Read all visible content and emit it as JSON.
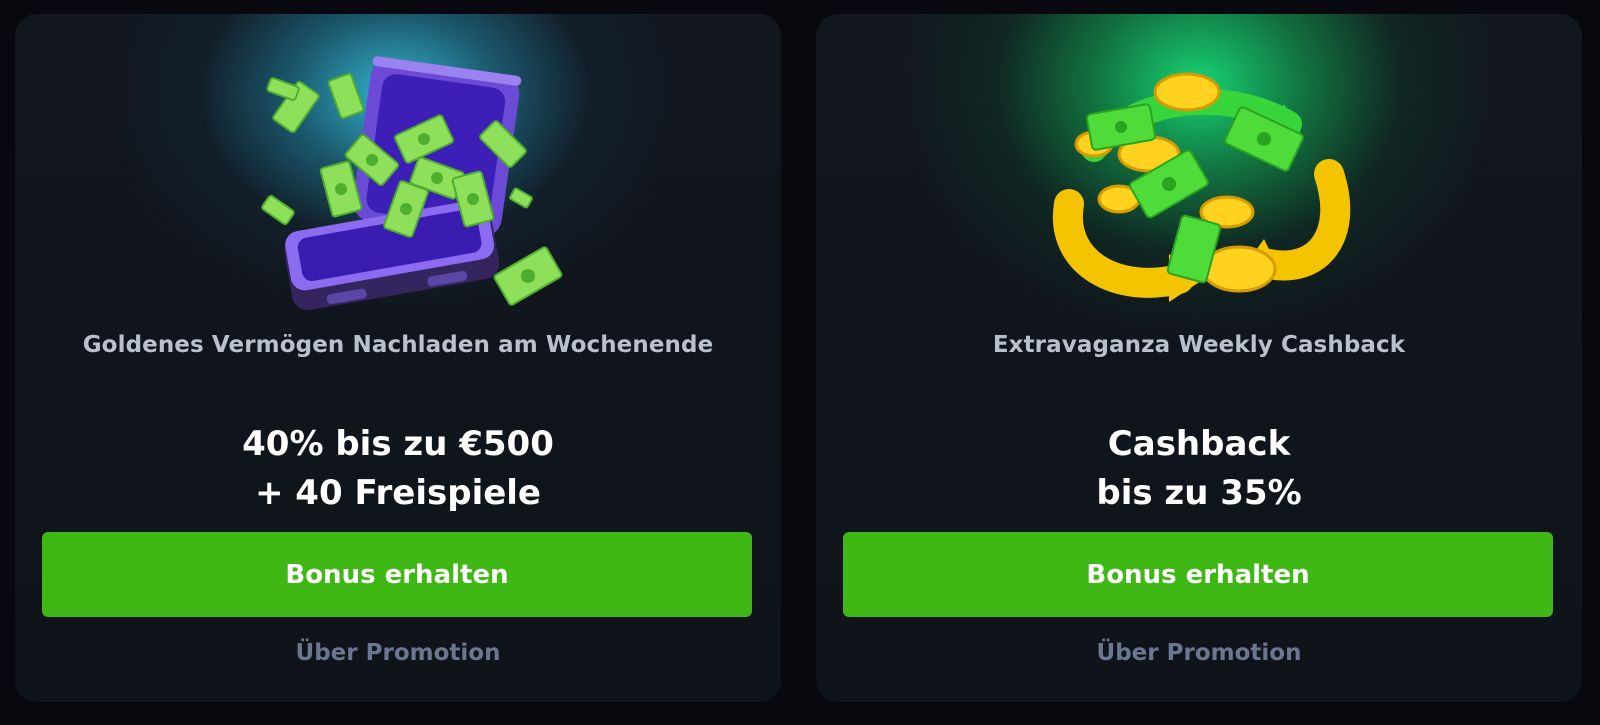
{
  "promotions": [
    {
      "title": "Goldenes Vermögen Nachladen am Wochenende",
      "offer_line1": "40% bis zu €500",
      "offer_line2": "+ 40 Freispiele",
      "button_label": "Bonus erhalten",
      "about_label": "Über Promotion",
      "icon": "money-briefcase-icon",
      "glow_color": "#34bed6"
    },
    {
      "title": "Extravaganza Weekly Cashback",
      "offer_line1": "Cashback",
      "offer_line2": "bis zu 35%",
      "button_label": "Bonus erhalten",
      "about_label": "Über Promotion",
      "icon": "cashback-coins-icon",
      "glow_color": "#18dc78"
    }
  ],
  "colors": {
    "background": "#07090e",
    "card": "#10141c",
    "button": "#3fb816",
    "title_text": "#b9c1cd",
    "about_text": "#6b7690"
  }
}
